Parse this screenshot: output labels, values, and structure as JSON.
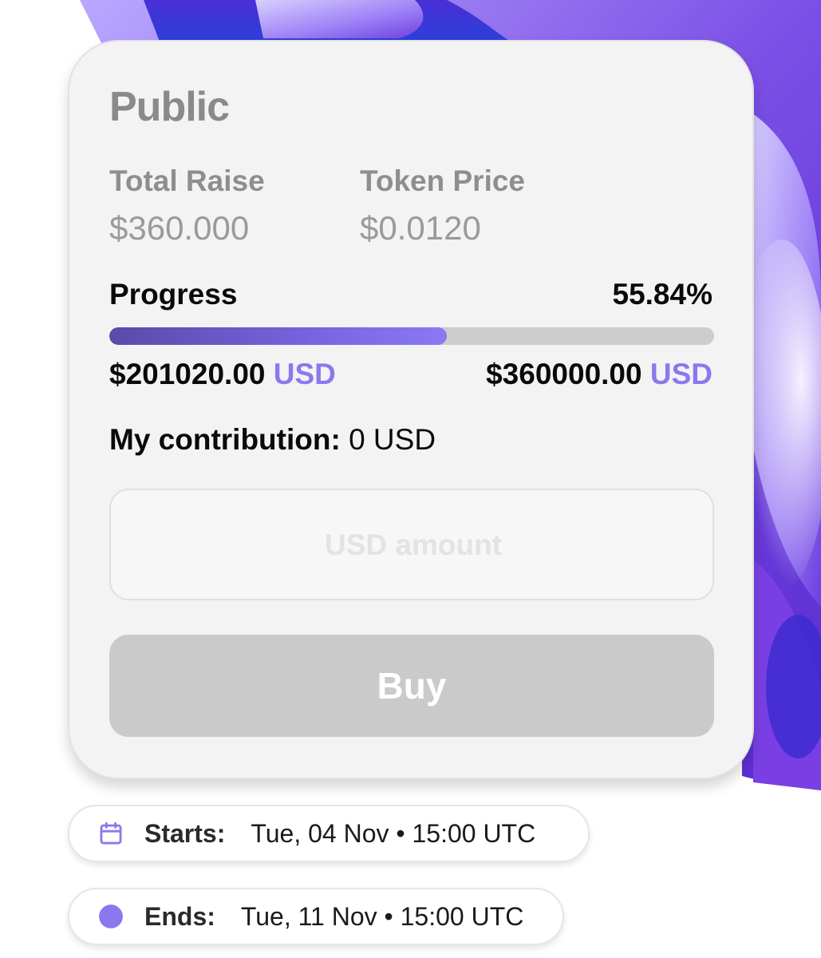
{
  "card": {
    "title": "Public",
    "total_raise": {
      "label": "Total Raise",
      "value": "$360.000"
    },
    "token_price": {
      "label": "Token Price",
      "value": "$0.0120"
    },
    "progress": {
      "label": "Progress",
      "percent_text": "55.84%",
      "fraction": 0.5584,
      "raised_amount": "$201020.00",
      "raised_currency": "USD",
      "target_amount": "$360000.00",
      "target_currency": "USD"
    },
    "contribution": {
      "label": "My contribution:",
      "value": "0 USD"
    },
    "amount_input": {
      "placeholder": "USD amount",
      "value": ""
    },
    "buy_label": "Buy"
  },
  "schedule": {
    "start": {
      "label": "Starts:",
      "value": "Tue, 04 Nov • 15:00 UTC",
      "icon": "calendar-icon"
    },
    "end": {
      "label": "Ends:",
      "value": "Tue, 11 Nov • 15:00 UTC",
      "icon": "status-dot-icon"
    }
  },
  "colors": {
    "accent": "#8a78ee",
    "bar_start": "#5b4aa8",
    "bar_end": "#8a79f4",
    "button_disabled": "#cacaca"
  }
}
